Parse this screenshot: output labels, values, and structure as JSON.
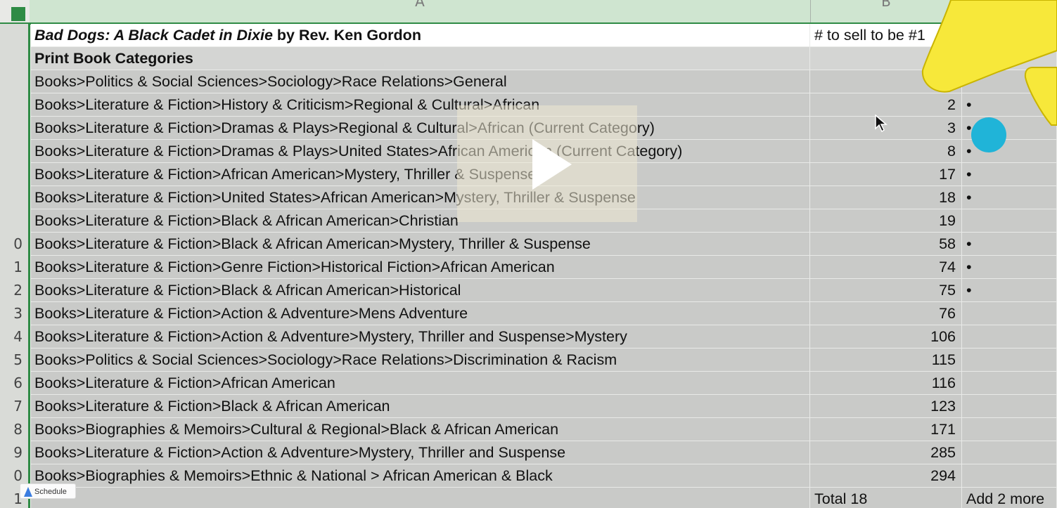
{
  "columns": {
    "a": "A",
    "b": "B"
  },
  "title_row": {
    "row_num": "",
    "title": "Bad Dogs: A Black Cadet in Dixie",
    "author": " by Rev. Ken Gordon",
    "col_b": "# to sell to be #1"
  },
  "category_header": {
    "row_num": "",
    "label": "Print Book Categories"
  },
  "rows": [
    {
      "num": "",
      "category": "Books>Politics & Social Sciences>Sociology>Race Relations>General",
      "value": "",
      "mark": ""
    },
    {
      "num": "",
      "category": "Books>Literature & Fiction>History & Criticism>Regional & Cultural>African",
      "value": "2",
      "mark": "•"
    },
    {
      "num": "",
      "category": "Books>Literature & Fiction>Dramas & Plays>Regional & Cultural>African (Current Category)",
      "value": "3",
      "mark": "•"
    },
    {
      "num": "",
      "category": "Books>Literature & Fiction>Dramas & Plays>United States>African American (Current Category)",
      "value": "8",
      "mark": "•"
    },
    {
      "num": "",
      "category": "Books>Literature & Fiction>African American>Mystery, Thriller & Suspense",
      "value": "17",
      "mark": "•"
    },
    {
      "num": "",
      "category": "Books>Literature & Fiction>United States>African American>Mystery, Thriller & Suspense",
      "value": "18",
      "mark": "•"
    },
    {
      "num": "",
      "category": "Books>Literature & Fiction>Black & African American>Christian",
      "value": "19",
      "mark": ""
    },
    {
      "num": "0",
      "category": "Books>Literature & Fiction>Black & African American>Mystery, Thriller & Suspense",
      "value": "58",
      "mark": "•"
    },
    {
      "num": "1",
      "category": "Books>Literature & Fiction>Genre Fiction>Historical Fiction>African American",
      "value": "74",
      "mark": "•"
    },
    {
      "num": "2",
      "category": "Books>Literature & Fiction>Black & African American>Historical",
      "value": "75",
      "mark": "•"
    },
    {
      "num": "3",
      "category": "Books>Literature & Fiction>Action & Adventure>Mens Adventure",
      "value": "76",
      "mark": ""
    },
    {
      "num": "4",
      "category": "Books>Literature & Fiction>Action & Adventure>Mystery, Thriller and Suspense>Mystery",
      "value": "106",
      "mark": ""
    },
    {
      "num": "5",
      "category": "Books>Politics & Social Sciences>Sociology>Race Relations>Discrimination & Racism",
      "value": "115",
      "mark": ""
    },
    {
      "num": "6",
      "category": "Books>Literature & Fiction>African American",
      "value": "116",
      "mark": ""
    },
    {
      "num": "7",
      "category": "Books>Literature & Fiction>Black & African American",
      "value": "123",
      "mark": ""
    },
    {
      "num": "8",
      "category": "Books>Biographies & Memoirs>Cultural & Regional>Black & African American",
      "value": "171",
      "mark": ""
    },
    {
      "num": "9",
      "category": "Books>Literature & Fiction>Action & Adventure>Mystery, Thriller and Suspense",
      "value": "285",
      "mark": ""
    },
    {
      "num": "0",
      "category": "Books>Biographies & Memoirs>Ethnic & National > African American & Black",
      "value": "294",
      "mark": ""
    }
  ],
  "footer_row": {
    "num": "1",
    "total": "Total 18",
    "add": "Add 2 more"
  },
  "schedule_badge": "Schedule",
  "colors": {
    "header_green": "#2f8b45",
    "highlight_yellow": "#f7e83a",
    "dot_cyan": "#20b4d8"
  }
}
